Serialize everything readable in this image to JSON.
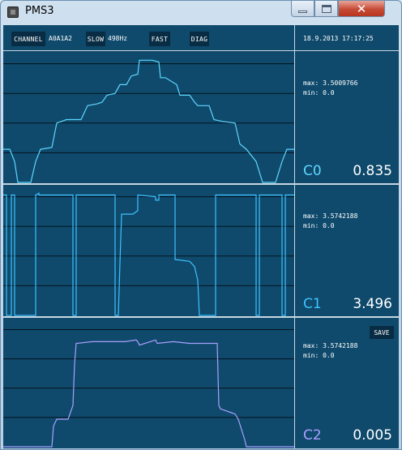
{
  "window": {
    "title": "PMS3"
  },
  "toolbar": {
    "channel_label": "CHANNEL",
    "channel_value": "A0A1A2",
    "slow_label": "SLOW",
    "rate": "498Hz",
    "fast_label": "FAST",
    "diag_label": "DIAG",
    "datetime": "18.9.2013 17:17:25"
  },
  "channels": [
    {
      "label": "C0",
      "value": "0.835",
      "max": "max: 3.5009766",
      "min": "min: 0.0",
      "color": "#5fd6ff"
    },
    {
      "label": "C1",
      "value": "3.496",
      "max": "max: 3.5742188",
      "min": "min: 0.0",
      "color": "#3ec1ff"
    },
    {
      "label": "C2",
      "value": "0.005",
      "max": "max: 3.5742188",
      "min": "min: 0.0",
      "color": "#a9a0ff",
      "save_label": "SAVE"
    }
  ],
  "chart_data": [
    {
      "type": "line",
      "name": "C0",
      "ylim": [
        0,
        3.6
      ],
      "grid": true,
      "x": [
        0,
        8,
        14,
        18,
        28,
        34,
        40,
        46,
        60,
        66,
        72,
        78,
        96,
        104,
        116,
        122,
        128,
        138,
        144,
        152,
        158,
        166,
        168,
        174,
        184,
        192,
        194,
        200,
        214,
        218,
        230,
        236,
        240,
        254,
        260,
        270,
        286,
        292,
        300,
        312,
        316,
        320,
        326,
        336,
        344,
        350,
        359
      ],
      "y": [
        0.95,
        0.95,
        0.6,
        0.0,
        0.0,
        0.0,
        0.6,
        0.95,
        1.0,
        1.7,
        1.75,
        1.8,
        1.8,
        2.2,
        2.25,
        2.3,
        2.5,
        2.55,
        2.8,
        2.8,
        3.05,
        3.1,
        3.5,
        3.5,
        3.5,
        3.45,
        3.0,
        3.0,
        2.8,
        2.5,
        2.5,
        2.3,
        2.2,
        2.2,
        1.8,
        1.75,
        1.7,
        1.1,
        0.95,
        0.6,
        0.3,
        0.0,
        0.0,
        0.0,
        0.6,
        0.95,
        0.95
      ]
    },
    {
      "type": "line",
      "name": "C1",
      "ylim": [
        0,
        3.6
      ],
      "grid": true,
      "x": [
        0,
        4,
        4,
        10,
        10,
        14,
        14,
        40,
        40,
        44,
        44,
        86,
        86,
        90,
        90,
        138,
        138,
        142,
        144,
        146,
        160,
        166,
        166,
        188,
        188,
        192,
        192,
        212,
        212,
        230,
        236,
        240,
        242,
        242,
        262,
        262,
        266,
        266,
        312,
        312,
        316,
        316,
        344,
        344,
        348,
        348,
        359
      ],
      "y": [
        3.45,
        3.45,
        0.0,
        0.0,
        3.45,
        3.45,
        0.0,
        0.0,
        3.45,
        3.5,
        3.45,
        3.45,
        0.0,
        0.0,
        3.45,
        3.45,
        0.0,
        0.0,
        1.5,
        2.9,
        2.9,
        3.0,
        3.45,
        3.4,
        3.3,
        3.3,
        3.45,
        3.45,
        1.6,
        1.55,
        1.4,
        1.0,
        0.0,
        0.0,
        0.0,
        3.45,
        3.45,
        3.45,
        3.45,
        0.0,
        0.0,
        3.45,
        3.45,
        0.0,
        0.0,
        3.45,
        3.45
      ]
    },
    {
      "type": "line",
      "name": "C2",
      "ylim": [
        0,
        3.6
      ],
      "grid": true,
      "x": [
        0,
        60,
        62,
        66,
        80,
        86,
        88,
        90,
        110,
        150,
        164,
        166,
        168,
        188,
        190,
        210,
        230,
        264,
        266,
        268,
        280,
        286,
        290,
        294,
        298,
        300,
        359
      ],
      "y": [
        0.0,
        0.0,
        0.6,
        0.8,
        0.8,
        1.2,
        2.4,
        3.0,
        3.05,
        3.05,
        3.1,
        3.05,
        2.95,
        3.1,
        3.0,
        3.05,
        3.0,
        3.0,
        1.2,
        1.1,
        1.0,
        0.95,
        0.8,
        0.5,
        0.2,
        0.0,
        0.0
      ]
    }
  ]
}
